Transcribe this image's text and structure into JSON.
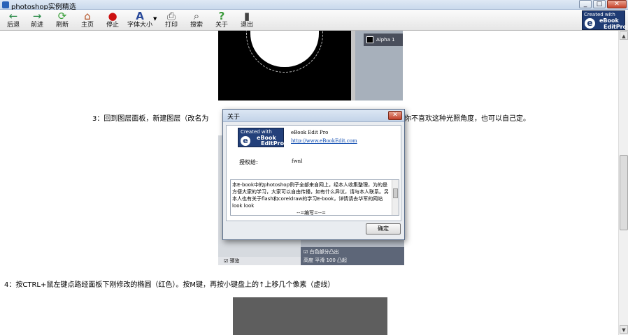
{
  "window": {
    "title": "photoshop实例精选",
    "minimize": "_",
    "maximize": "□",
    "close": "✕"
  },
  "toolbar": {
    "items": [
      {
        "label": "后退",
        "icon": "←",
        "color": "#2a8a48"
      },
      {
        "label": "前进",
        "icon": "→",
        "color": "#2a8a48"
      },
      {
        "label": "刷新",
        "icon": "⟳",
        "color": "#3aa03a"
      },
      {
        "label": "主页",
        "icon": "⌂",
        "color": "#b04a1c"
      },
      {
        "label": "停止",
        "icon": "●",
        "color": "#cc1111"
      },
      {
        "label": "字体大小",
        "icon": "A",
        "color": "#2a4a9a"
      },
      {
        "label": "打印",
        "icon": "⎙",
        "color": "#555555"
      },
      {
        "label": "搜索",
        "icon": "⌕",
        "color": "#444444"
      },
      {
        "label": "关于",
        "icon": "?",
        "color": "#3a9a3a"
      },
      {
        "label": "退出",
        "icon": "▮",
        "color": "#444444"
      }
    ],
    "dropdown_arrow": "▼",
    "brand": {
      "line1": "Created with",
      "letter": "e",
      "line2": "eBook",
      "line3": "EditPro"
    }
  },
  "content": {
    "screenshot1": {
      "layer_name": "Alpha 1"
    },
    "step3": "3：回到图层面板，新建图层（改名为",
    "step3_suffix": "你不喜欢这种光照角度，也可以自己定。",
    "screenshot2": {
      "bottom_check": "☑ 白色部分凸出",
      "bottom_row": "高度     平滑      100     凸起",
      "bottom_left": "☑ 预览"
    },
    "step4": "4：按CTRL+鼠左键点路经面板下刚修改的椭圆（红色）。按M键，再按小键盘上的↑上移几个像素（虚线）"
  },
  "dialog": {
    "title": "关于",
    "close": "✕",
    "logo": {
      "line1": "Created with",
      "letter": "e",
      "line2": "eBook",
      "line3": "EditPro"
    },
    "product": "eBook Edit Pro",
    "link": "http://www.eBookEdit.com",
    "licensed_label": "授权给:",
    "licensed_value": "fwnl",
    "description": "本E-book中的photoshop例子全部来自网上，经本人收集整理，为的是方便大家的学习，大家可以自由传播，如有什么异议，请与本人联系。另本人也有关于flash和coreldraw的学习E-book，详情请去华军的网站look look",
    "description_tail": "--=编写=--=",
    "ok": "确定"
  },
  "scrollbar": {
    "up": "▲",
    "down": "▼"
  }
}
